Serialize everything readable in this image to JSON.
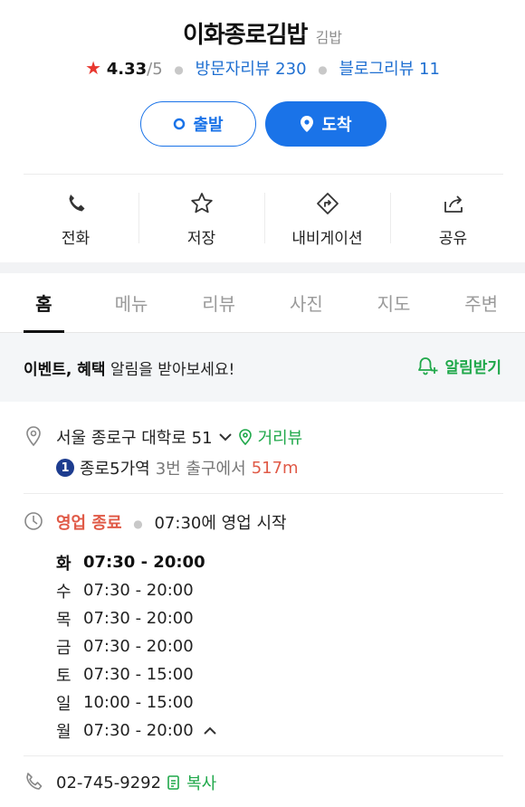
{
  "place": {
    "name": "이화종로김밥",
    "category": "김밥",
    "rating": "4.33",
    "rating_max": "/5",
    "visitor_reviews": "방문자리뷰 230",
    "blog_reviews": "블로그리뷰 11"
  },
  "route": {
    "depart_label": "출발",
    "arrive_label": "도착"
  },
  "actions": [
    {
      "label": "전화",
      "icon": "phone-icon"
    },
    {
      "label": "저장",
      "icon": "star-icon"
    },
    {
      "label": "내비게이션",
      "icon": "navigation-icon"
    },
    {
      "label": "공유",
      "icon": "share-icon"
    }
  ],
  "tabs": [
    "홈",
    "메뉴",
    "리뷰",
    "사진",
    "지도",
    "주변"
  ],
  "active_tab": "홈",
  "event": {
    "strong": "이벤트, 혜택",
    "text": " 알림을 받아보세요!",
    "button": "알림받기"
  },
  "address": {
    "text": "서울 종로구 대학로 51",
    "street_view": "거리뷰",
    "subway_line": "1",
    "station": "종로5가역",
    "exit": "3번 출구에서",
    "distance": "517m"
  },
  "business": {
    "status": "영업 종료",
    "next": "07:30에 영업 시작",
    "hours": [
      {
        "day": "화",
        "time": "07:30 - 20:00"
      },
      {
        "day": "수",
        "time": "07:30 - 20:00"
      },
      {
        "day": "목",
        "time": "07:30 - 20:00"
      },
      {
        "day": "금",
        "time": "07:30 - 20:00"
      },
      {
        "day": "토",
        "time": "07:30 - 15:00"
      },
      {
        "day": "일",
        "time": "10:00 - 15:00"
      },
      {
        "day": "월",
        "time": "07:30 - 20:00"
      }
    ]
  },
  "contact": {
    "phone": "02-745-9292",
    "copy": "복사"
  },
  "colors": {
    "primary_blue": "#1a73e8",
    "green": "#1fa84a",
    "red": "#e05a47",
    "star": "#e8372f"
  }
}
